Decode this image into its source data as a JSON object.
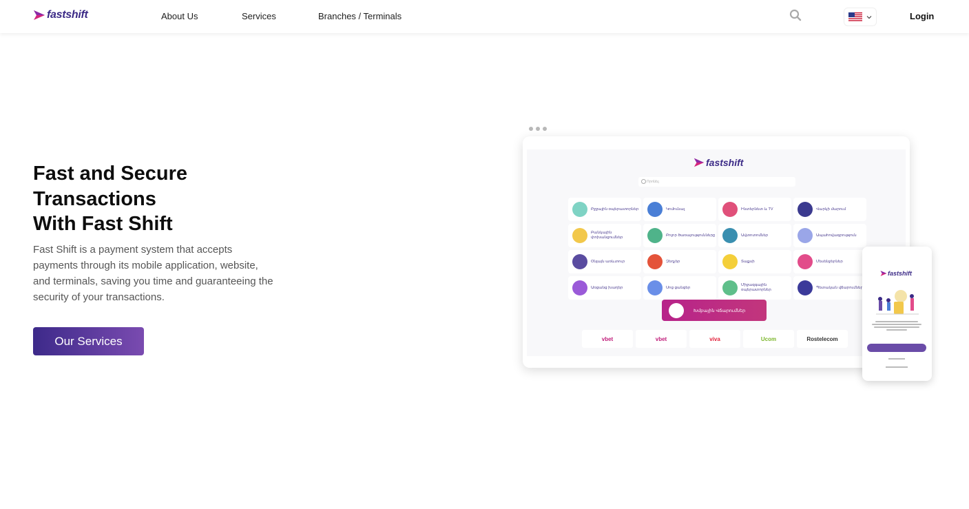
{
  "header": {
    "logo_text": "fastshift",
    "nav": {
      "about": "About Us",
      "services": "Services",
      "branches": "Branches / Terminals"
    },
    "login": "Login"
  },
  "hero": {
    "title_lines": [
      "Fast and Secure",
      "Transactions",
      "With Fast Shift"
    ],
    "description": "Fast Shift is a payment system that accepts payments through its mobile application, website, and terminals, saving you time and guaranteeing the security of your transactions.",
    "cta_label": "Our Services"
  },
  "mockup": {
    "logo_text": "fastshift",
    "search_placeholder": "Որոնել",
    "services": [
      {
        "label": "Բջջային օպերատորներ",
        "color": "#7fd3c4"
      },
      {
        "label": "Կոմունալ",
        "color": "#4a7fd6"
      },
      {
        "label": "Ինտերնետ և TV",
        "color": "#e0507a"
      },
      {
        "label": "Վարկի մարում",
        "color": "#3b3a8f"
      },
      {
        "label": "Բանկային փոխանցումներ",
        "color": "#f2c84b"
      },
      {
        "label": "Բոլոր ծառայությունները",
        "color": "#4fb38a"
      },
      {
        "label": "Ավտոտոմներ",
        "color": "#3a8fb0"
      },
      {
        "label": "Ապահովագրություն",
        "color": "#9aa6e8"
      },
      {
        "label": "Օնլայն առևտուր",
        "color": "#5a4ca0"
      },
      {
        "label": "Զեղչեր",
        "color": "#e4533a"
      },
      {
        "label": "Տաքսի",
        "color": "#f4cf3a"
      },
      {
        "label": "Մեսենջերներ",
        "color": "#e24c8a"
      },
      {
        "label": "Առցանց խաղեր",
        "color": "#9a5ad8"
      },
      {
        "label": "Սոց ցանցեր",
        "color": "#6a8fe8"
      },
      {
        "label": "Միջազգային օպերատորներ",
        "color": "#5fbf8a"
      },
      {
        "label": "Պետական վճարումներ",
        "color": "#3b3a9a"
      }
    ],
    "button_label": "Խմբային Վճարումներ",
    "partners": [
      {
        "label": "vbet",
        "color": "#c01d7a"
      },
      {
        "label": "vbet",
        "color": "#c01d7a"
      },
      {
        "label": "viva",
        "color": "#e2203a"
      },
      {
        "label": "Ucom",
        "color": "#7ab52a"
      },
      {
        "label": "Rostelecom",
        "color": "#333333"
      }
    ],
    "phone_logo_text": "fastshift"
  },
  "colors": {
    "brand": "#3b2a86",
    "accent": "#7a4bb0",
    "magenta": "#c2367c"
  }
}
